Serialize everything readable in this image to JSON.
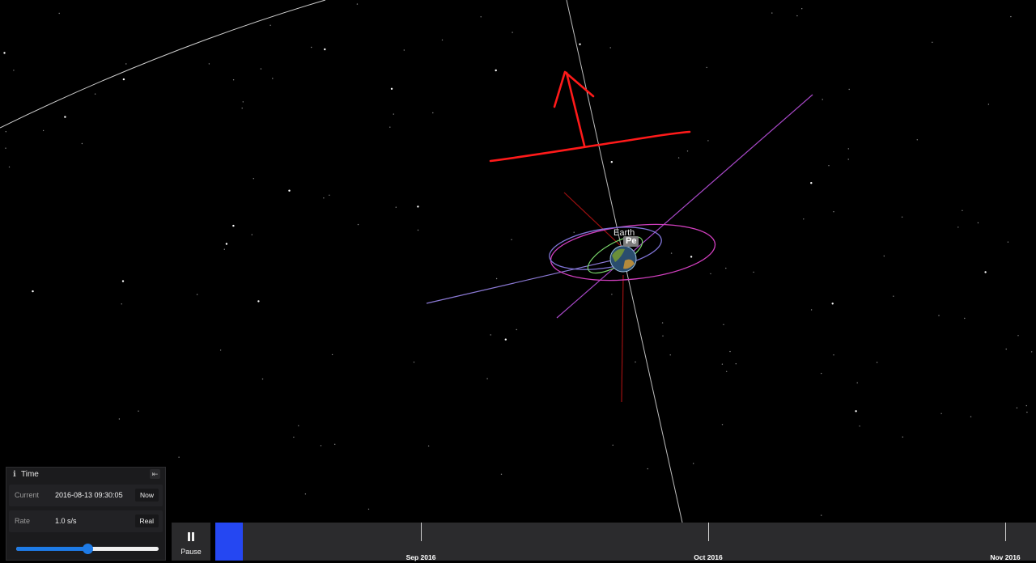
{
  "scene": {
    "body_label": "Earth",
    "periapsis_label": "Pe"
  },
  "time_panel": {
    "icon": "info-icon",
    "title": "Time",
    "collapse_icon": "collapse-left-icon",
    "current": {
      "label": "Current",
      "value": "2016-08-13 09:30:05",
      "button": "Now"
    },
    "rate": {
      "label": "Rate",
      "value": "1.0 s/s",
      "button": "Real",
      "slider_fraction": 0.5
    }
  },
  "timeline": {
    "pause_icon": "pause-icon",
    "pause_label": "Pause",
    "ticks": [
      {
        "label": "Sep 2016"
      },
      {
        "label": "Oct 2016"
      },
      {
        "label": "Nov 2016"
      }
    ]
  },
  "colors": {
    "background": "#000000",
    "accent": "#2547f2",
    "slider": "#1e7be6",
    "annotation": "#ff1a1a",
    "orbit_magenta": "#d23fbf",
    "orbit_violet": "#8c7ad6"
  }
}
